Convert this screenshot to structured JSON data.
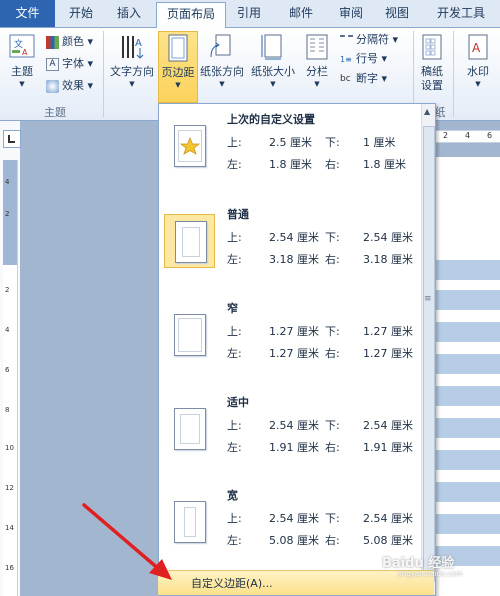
{
  "tabs": [
    {
      "label": "文件"
    },
    {
      "label": "开始"
    },
    {
      "label": "插入"
    },
    {
      "label": "页面布局"
    },
    {
      "label": "引用"
    },
    {
      "label": "邮件"
    },
    {
      "label": "审阅"
    },
    {
      "label": "视图"
    },
    {
      "label": "开发工具"
    }
  ],
  "ribbon": {
    "theme": {
      "label": "主题",
      "group_label": "主题",
      "colors": "颜色",
      "fonts": "字体",
      "effects": "效果"
    },
    "text_direction": "文字方向",
    "margins": "页边距",
    "orientation": "纸张方向",
    "size": "纸张大小",
    "columns": "分栏",
    "breaks": "分隔符",
    "line_numbers": "行号",
    "hyphenation": "断字",
    "watermark_pre": "稿纸",
    "watermark_pre2": "设置",
    "watermark_pre_group": "纸",
    "watermark": "水印"
  },
  "ruler": {
    "h_ticks": [
      "2",
      "4",
      "6"
    ],
    "v_numbers": [
      "4",
      "2",
      "2",
      "4",
      "6",
      "8",
      "10",
      "12",
      "14",
      "16"
    ]
  },
  "margins_menu": {
    "items": [
      {
        "name": "上次的自定义设置",
        "top_label": "上:",
        "top": "2.5 厘米",
        "bottom_label": "下:",
        "bottom": "1 厘米",
        "left_label": "左:",
        "left": "1.8 厘米",
        "right_label": "右:",
        "right": "1.8 厘米"
      },
      {
        "name": "普通",
        "top_label": "上:",
        "top": "2.54 厘米",
        "bottom_label": "下:",
        "bottom": "2.54 厘米",
        "left_label": "左:",
        "left": "3.18 厘米",
        "right_label": "右:",
        "right": "3.18 厘米"
      },
      {
        "name": "窄",
        "top_label": "上:",
        "top": "1.27 厘米",
        "bottom_label": "下:",
        "bottom": "1.27 厘米",
        "left_label": "左:",
        "left": "1.27 厘米",
        "right_label": "右:",
        "right": "1.27 厘米"
      },
      {
        "name": "适中",
        "top_label": "上:",
        "top": "2.54 厘米",
        "bottom_label": "下:",
        "bottom": "2.54 厘米",
        "left_label": "左:",
        "left": "1.91 厘米",
        "right_label": "右:",
        "right": "1.91 厘米"
      },
      {
        "name": "宽",
        "top_label": "上:",
        "top": "2.54 厘米",
        "bottom_label": "下:",
        "bottom": "2.54 厘米",
        "left_label": "左:",
        "left": "5.08 厘米",
        "right_label": "右:",
        "right": "5.08 厘米"
      }
    ],
    "custom_label": "自定义边距(A)..."
  },
  "watermark_overlay": {
    "brand": "Baidu 经验",
    "sub": "jingyan.baidu.com"
  },
  "colors": {
    "accent": "#2d65b0",
    "selected": "#fbd35c",
    "annotation_arrow": "#e02020"
  }
}
